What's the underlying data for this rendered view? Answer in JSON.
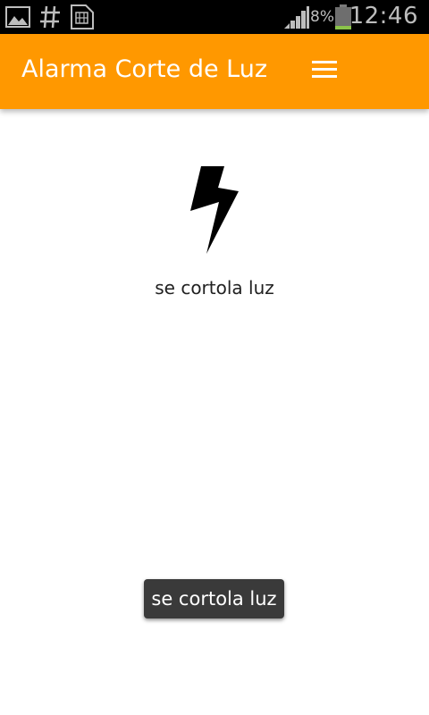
{
  "status_bar": {
    "icons": [
      "gallery-icon",
      "hash-icon",
      "sim-card-icon"
    ],
    "signal_icon": "signal-bars-icon",
    "battery_percent": "8%",
    "battery_icon": "battery-icon",
    "battery_level": 0.08,
    "clock": "12:46"
  },
  "app_bar": {
    "title": "Alarma Corte de Luz",
    "menu_icon": "hamburger-menu-icon",
    "color": "#ff9800"
  },
  "main": {
    "icon": "lightning-bolt-icon",
    "status_text": "se cortola luz"
  },
  "toast": {
    "message": "se cortola luz"
  }
}
